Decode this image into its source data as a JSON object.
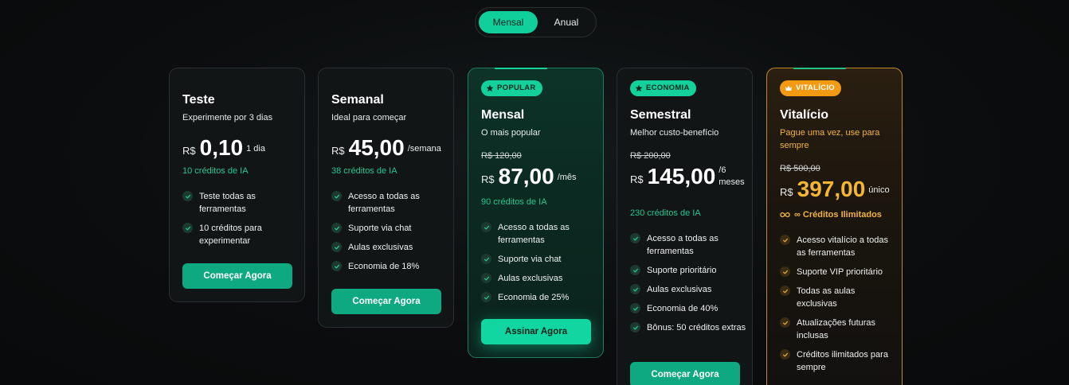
{
  "toggle": {
    "monthly_label": "Mensal",
    "annual_label": "Anual"
  },
  "plans": [
    {
      "name": "Teste",
      "subtitle": "Experimente por 3 dias",
      "currency": "R$",
      "price": "0,10",
      "period": "1 dia",
      "credits": "10 créditos de IA",
      "features": [
        "Teste todas as ferramentas",
        "10 créditos para experimentar"
      ],
      "button": "Começar Agora"
    },
    {
      "name": "Semanal",
      "subtitle": "Ideal para começar",
      "currency": "R$",
      "price": "45,00",
      "period": "/semana",
      "credits": "38 créditos de IA",
      "features": [
        "Acesso a todas as ferramentas",
        "Suporte via chat",
        "Aulas exclusivas",
        "Economia de 18%"
      ],
      "button": "Começar Agora"
    },
    {
      "badge": "POPULAR",
      "badge_icon": "star-icon",
      "name": "Mensal",
      "subtitle": "O mais popular",
      "old_price": "R$ 120,00",
      "currency": "R$",
      "price": "87,00",
      "period": "/mês",
      "credits": "90 créditos de IA",
      "features": [
        "Acesso a todas as ferramentas",
        "Suporte via chat",
        "Aulas exclusivas",
        "Economia de 25%"
      ],
      "button": "Assinar Agora"
    },
    {
      "badge": "ECONOMIA",
      "badge_icon": "star-icon",
      "name": "Semestral",
      "subtitle": "Melhor custo-benefício",
      "old_price": "R$ 200,00",
      "currency": "R$",
      "price": "145,00",
      "period": "/6 meses",
      "credits": "230 créditos de IA",
      "features": [
        "Acesso a todas as ferramentas",
        "Suporte prioritário",
        "Aulas exclusivas",
        "Economia de 40%",
        "Bônus: 50 créditos extras"
      ],
      "button": "Começar Agora"
    },
    {
      "badge": "VITALÍCIO",
      "badge_icon": "crown-icon",
      "name": "Vitalício",
      "subtitle": "Pague uma vez, use para sempre",
      "old_price": "R$ 500,00",
      "currency": "R$",
      "price": "397,00",
      "period": "único",
      "credits": "∞ Créditos Ilimitados",
      "credits_icon": "infinity-icon",
      "features": [
        "Acesso vitalício a todas as ferramentas",
        "Suporte VIP prioritário",
        "Todas as aulas exclusivas",
        "Atualizações futuras inclusas",
        "Créditos ilimitados para sempre"
      ]
    }
  ],
  "colors": {
    "accent": "#10cf9b",
    "gold": "#f5b733",
    "background": "#0b0d0e"
  }
}
